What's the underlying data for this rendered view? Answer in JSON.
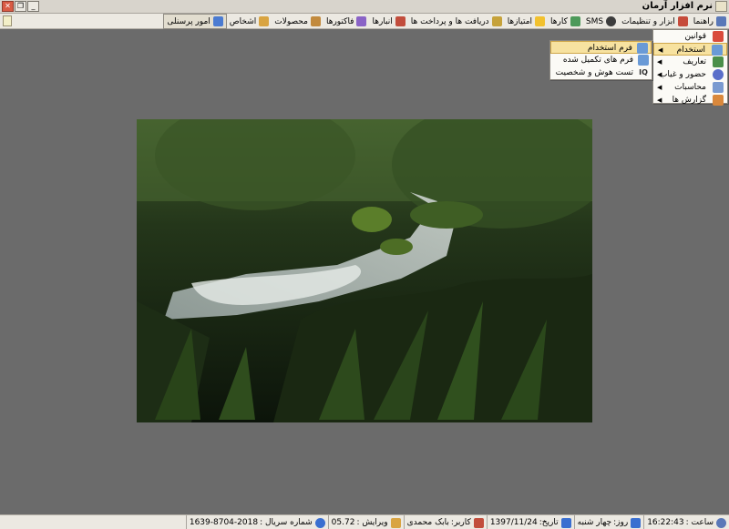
{
  "window": {
    "title": "نرم افزار آرمان",
    "controls": {
      "close": "✕",
      "restore": "❐",
      "minimize": "_"
    }
  },
  "menu": {
    "items": [
      {
        "label": "امور پرسنلی",
        "icon": "people-icon",
        "color": "#4b7bd1",
        "active": true
      },
      {
        "label": "اشخاص",
        "icon": "person-icon",
        "color": "#d9a441"
      },
      {
        "label": "محصولات",
        "icon": "box-icon",
        "color": "#c28a3d"
      },
      {
        "label": "فاکتورها",
        "icon": "invoice-icon",
        "color": "#8a63c6"
      },
      {
        "label": "انبارها",
        "icon": "warehouse-icon",
        "color": "#c24d3c"
      },
      {
        "label": "دریافت ها و پرداخت ها",
        "icon": "money-bag-icon",
        "color": "#c6a23a"
      },
      {
        "label": "امتیازها",
        "icon": "star-icon",
        "color": "#f2c12e"
      },
      {
        "label": "کارها",
        "icon": "tasks-icon",
        "color": "#4d9a5a"
      },
      {
        "label": "SMS",
        "icon": "chat-icon",
        "color": "#3c3c3c"
      },
      {
        "label": "ابزار و تنظیمات",
        "icon": "tools-icon",
        "color": "#c64b3b"
      },
      {
        "label": "راهنما",
        "icon": "help-icon",
        "color": "#5a78b8"
      }
    ]
  },
  "dropdown": {
    "items": [
      {
        "label": "قوانین",
        "icon": "rules-icon",
        "color": "#d94b3c",
        "submenu": false
      },
      {
        "label": "استخدام",
        "icon": "hire-icon",
        "color": "#6a9ad6",
        "submenu": true,
        "highlight": true
      },
      {
        "label": "تعاریف",
        "icon": "definitions-icon",
        "color": "#4b8f4a",
        "submenu": true
      },
      {
        "label": "حضور و غیاب",
        "icon": "clock-icon",
        "color": "#5a6ec9",
        "submenu": true
      },
      {
        "label": "محاسبات",
        "icon": "calculator-icon",
        "color": "#7a9ad0",
        "submenu": true
      },
      {
        "label": "گزارش ها",
        "icon": "report-chart-icon",
        "color": "#d9883c",
        "submenu": true
      }
    ]
  },
  "submenu": {
    "items": [
      {
        "label": "فرم استخدام",
        "icon": "form-icon",
        "color": "#6a9ad6",
        "highlight": true
      },
      {
        "label": "فرم های تکمیل شده",
        "icon": "forms-done-icon",
        "color": "#6a9ad6"
      },
      {
        "label": "تست هوش و شخصیت",
        "icon": "iq-test-icon",
        "color": "#2f2f2f",
        "glyph": "IQ"
      }
    ]
  },
  "status": {
    "serial_label": "شماره سریال :",
    "serial_value": "1639-8704-2018",
    "version_label": "ویرایش :",
    "version_value": "05.72",
    "user_label": "کاربر:",
    "user_value": "بابک محمدی",
    "date_label": "تاریخ:",
    "date_value": "1397/11/24",
    "day_label": "روز:",
    "day_value": "چهار شنبه",
    "time_label": "ساعت :",
    "time_value": "16:22:43",
    "colors": {
      "globe": "#3a6fd0",
      "pencil": "#d9a441",
      "users": "#c24d3c",
      "calendar": "#3a6fd0",
      "clock": "#5a78b8"
    }
  }
}
